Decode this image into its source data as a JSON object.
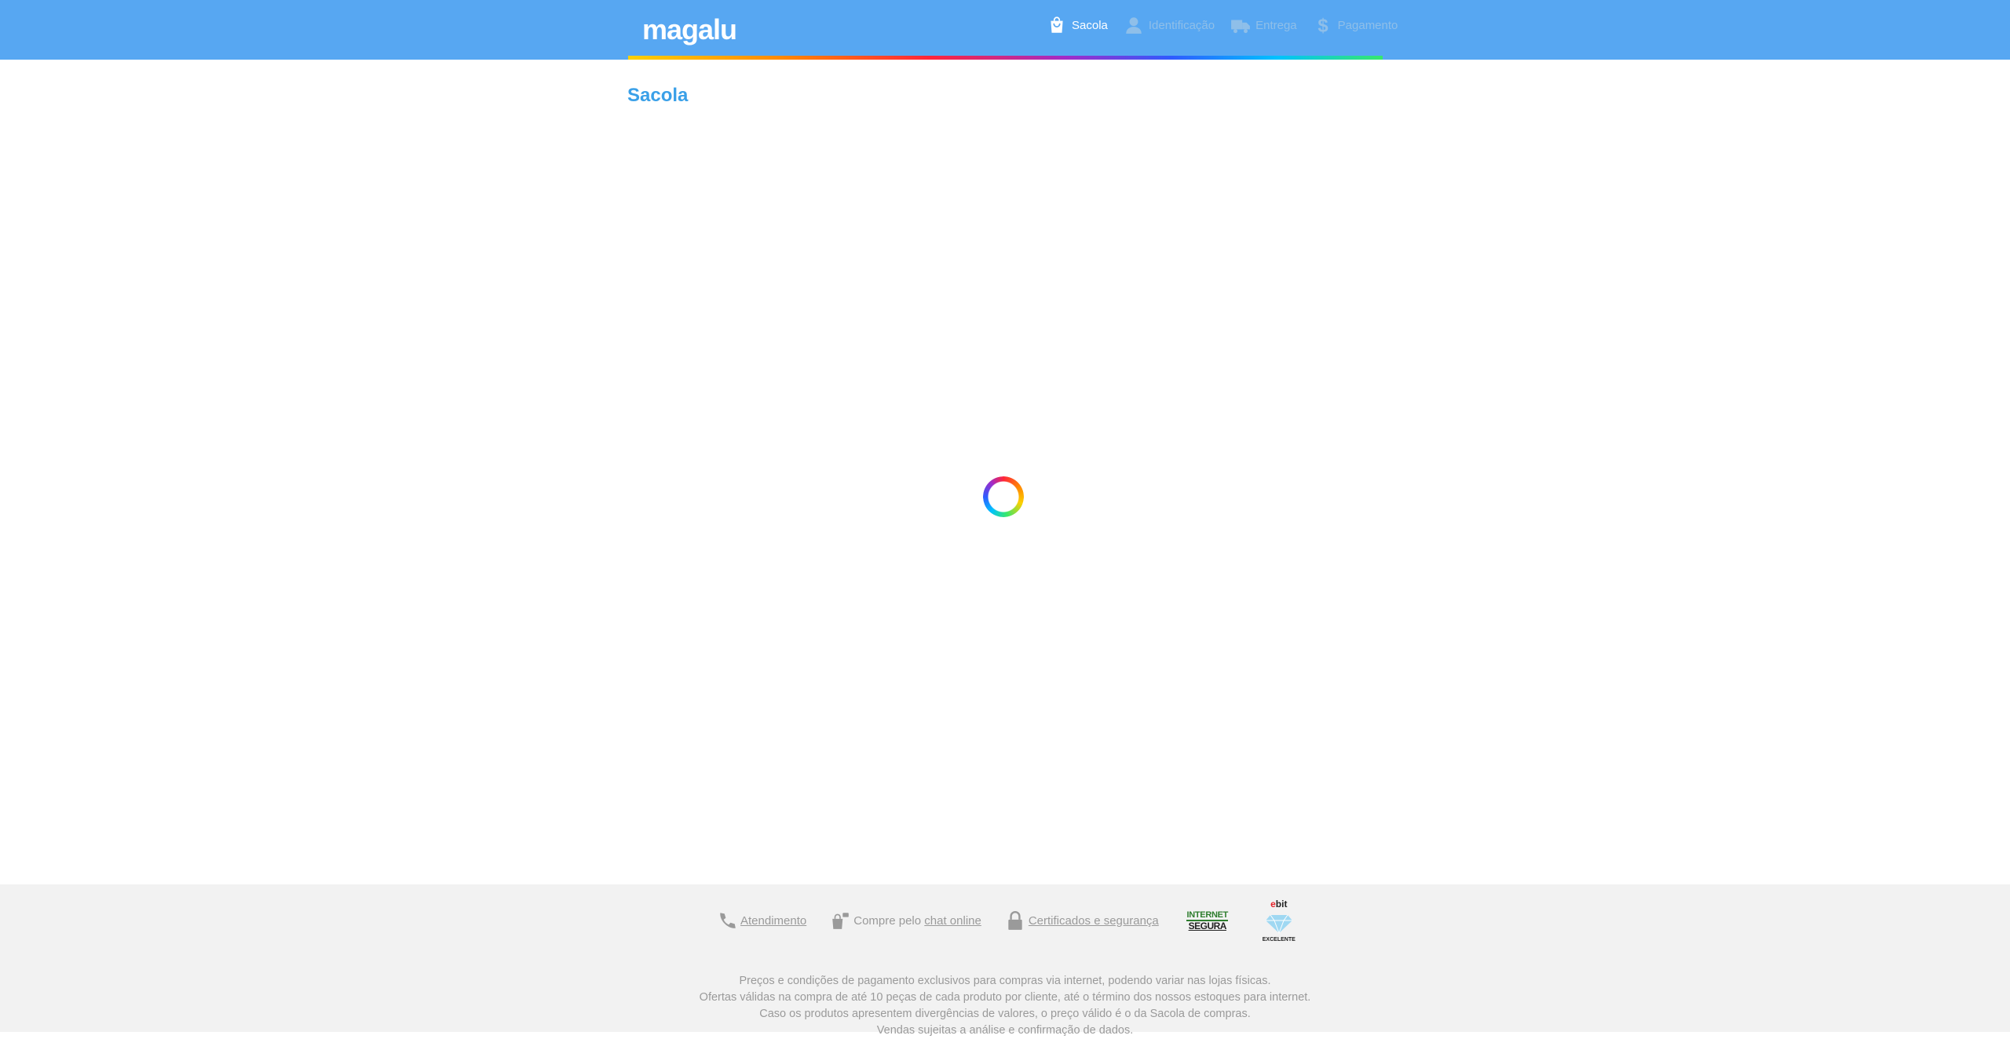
{
  "header": {
    "logo": "magalu",
    "steps": [
      {
        "label": "Sacola",
        "icon": "shopping-bag-icon",
        "active": true
      },
      {
        "label": "Identificação",
        "icon": "user-icon",
        "active": false
      },
      {
        "label": "Entrega",
        "icon": "truck-icon",
        "active": false
      },
      {
        "label": "Pagamento",
        "icon": "dollar-icon",
        "active": false
      }
    ],
    "bar_color": "#57a7f2"
  },
  "main": {
    "title": "Sacola",
    "loading": true
  },
  "footer": {
    "links": {
      "atendimento": "Atendimento",
      "chat_prefix": "Compre pelo ",
      "chat_link": "chat online",
      "certificados": "Certificados e segurança"
    },
    "seals": {
      "internet_segura_line1": "INTERNET",
      "internet_segura_line2": "SEGURA",
      "ebit_brand": "bit",
      "ebit_prefix": "e",
      "ebit_rating": "EXCELENTE"
    },
    "disclaimer": [
      "Preços e condições de pagamento exclusivos para compras via internet, podendo variar nas lojas físicas.",
      "Ofertas válidas na compra de até 10 peças de cada produto por cliente, até o término dos nossos estoques para internet.",
      "Caso os produtos apresentem divergências de valores, o preço válido é o da Sacola de compras.",
      "Vendas sujeitas a análise e confirmação de dados."
    ]
  }
}
